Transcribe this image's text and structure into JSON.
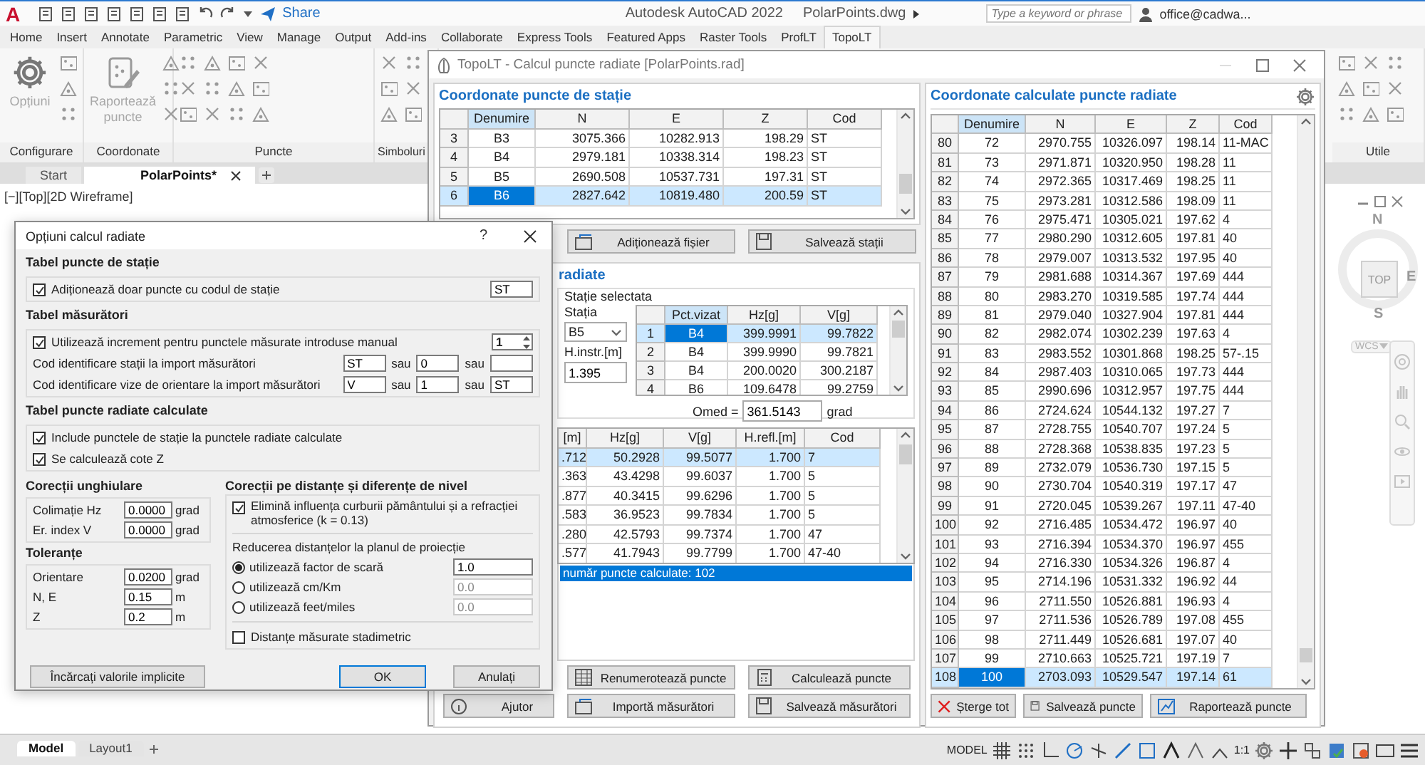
{
  "app": {
    "logo": "A",
    "share": "Share",
    "title": "Autodesk AutoCAD 2022",
    "file": "PolarPoints.dwg",
    "search_placeholder": "Type a keyword or phrase",
    "user": "office@cadwa..."
  },
  "ribbon_tabs": [
    {
      "label": "Home",
      "selected": false
    },
    {
      "label": "Insert",
      "selected": false
    },
    {
      "label": "Annotate",
      "selected": false
    },
    {
      "label": "Parametric",
      "selected": false
    },
    {
      "label": "View",
      "selected": false
    },
    {
      "label": "Manage",
      "selected": false
    },
    {
      "label": "Output",
      "selected": false
    },
    {
      "label": "Add-ins",
      "selected": false
    },
    {
      "label": "Collaborate",
      "selected": false
    },
    {
      "label": "Express Tools",
      "selected": false
    },
    {
      "label": "Featured Apps",
      "selected": false
    },
    {
      "label": "Raster Tools",
      "selected": false
    },
    {
      "label": "ProfLT",
      "selected": false
    },
    {
      "label": "TopoLT",
      "selected": true
    }
  ],
  "ribbon_panels": [
    {
      "title": "Configurare",
      "kind": "large",
      "tool": "Opțiuni"
    },
    {
      "title": "Coordonate",
      "kind": "large",
      "tool": "Raportează puncte"
    },
    {
      "title": "Puncte",
      "kind": "small"
    },
    {
      "title": "Simboluri",
      "kind": "small"
    },
    {
      "title": "Utile",
      "kind": "small"
    }
  ],
  "doc_tabs": [
    {
      "label": "Start",
      "selected": false
    },
    {
      "label": "PolarPoints*",
      "selected": true
    }
  ],
  "viewport_label": "[−][Top][2D Wireframe]",
  "viewcube": {
    "north": "N",
    "face": "TOP",
    "east": "E",
    "south": "S",
    "ucs": "WCS"
  },
  "layout_tabs": [
    {
      "label": "Model",
      "selected": true
    },
    {
      "label": "Layout1",
      "selected": false
    }
  ],
  "status_bar": {
    "space": "MODEL",
    "scale": "1:1"
  },
  "topolt": {
    "title": "TopoLT - Calcul puncte radiate [PolarPoints.rad]",
    "stations": {
      "title": "Coordonate puncte de stație",
      "columns": [
        {
          "label": "Denumire",
          "selected": true
        },
        {
          "label": "N",
          "selected": false
        },
        {
          "label": "E",
          "selected": false
        },
        {
          "label": "Z",
          "selected": false
        },
        {
          "label": "Cod",
          "selected": false
        }
      ],
      "rows": [
        {
          "index": "3",
          "cells": [
            "B3",
            "3075.366",
            "10282.913",
            "198.29",
            "ST"
          ],
          "selected": false
        },
        {
          "index": "4",
          "cells": [
            "B4",
            "2979.181",
            "10338.314",
            "198.23",
            "ST"
          ],
          "selected": false
        },
        {
          "index": "5",
          "cells": [
            "B5",
            "2690.508",
            "10537.731",
            "197.31",
            "ST"
          ],
          "selected": false
        },
        {
          "index": "6",
          "cells": [
            "B6",
            "2827.642",
            "10819.480",
            "200.59",
            "ST"
          ],
          "selected": true
        }
      ]
    },
    "station_buttons": [
      "Adiționează fișier",
      "Salvează stații"
    ],
    "measurements": {
      "title": "radiate",
      "group": "Stație selectata",
      "station_label": "Stația",
      "station_value": "B5",
      "height_label": "H.instr.[m]",
      "height_value": "1.395",
      "sights": {
        "columns": [
          {
            "label": "Pct.vizat",
            "selected": true
          },
          {
            "label": "Hz[g]",
            "selected": false
          },
          {
            "label": "V[g]",
            "selected": false
          }
        ],
        "rows": [
          {
            "index": "1",
            "cells": [
              "B4",
              "399.9991",
              "99.7822"
            ],
            "selected": true
          },
          {
            "index": "2",
            "cells": [
              "B4",
              "399.9990",
              "99.7821"
            ],
            "selected": false
          },
          {
            "index": "3",
            "cells": [
              "B4",
              "200.0020",
              "300.2187"
            ],
            "selected": false
          },
          {
            "index": "4",
            "cells": [
              "B6",
              "109.6478",
              "99.2759"
            ],
            "selected": false
          }
        ]
      },
      "omed_label": "Omed =",
      "omed_value": "361.5143",
      "omed_unit": "grad"
    },
    "observations": {
      "columns": [
        {
          "label": "[m]",
          "selected": false
        },
        {
          "label": "Hz[g]",
          "selected": false
        },
        {
          "label": "V[g]",
          "selected": false
        },
        {
          "label": "H.refl.[m]",
          "selected": false
        },
        {
          "label": "Cod",
          "selected": false
        }
      ],
      "rows": [
        {
          "cells": [
            ".712",
            "50.2928",
            "99.5077",
            "1.700",
            "7"
          ],
          "selected": true
        },
        {
          "cells": [
            ".363",
            "43.4298",
            "99.6037",
            "1.700",
            "5"
          ],
          "selected": false
        },
        {
          "cells": [
            ".877",
            "40.3415",
            "99.6296",
            "1.700",
            "5"
          ],
          "selected": false
        },
        {
          "cells": [
            ".583",
            "36.9523",
            "99.7834",
            "1.700",
            "5"
          ],
          "selected": false
        },
        {
          "cells": [
            ".280",
            "42.5793",
            "99.7374",
            "1.700",
            "47"
          ],
          "selected": false
        },
        {
          "cells": [
            ".577",
            "41.7943",
            "99.7799",
            "1.700",
            "47-40"
          ],
          "selected": false
        }
      ]
    },
    "log": [
      {
        "text": "număr puncte calculate: 102",
        "selected": true
      }
    ],
    "buttons": [
      "Renumerotează puncte",
      "Calculează puncte",
      "Importă măsurători",
      "Salvează măsurători"
    ],
    "help_button": "Ajutor",
    "results": {
      "title": "Coordonate calculate puncte radiate",
      "columns": [
        {
          "label": "Denumire",
          "selected": true
        },
        {
          "label": "N",
          "selected": false
        },
        {
          "label": "E",
          "selected": false
        },
        {
          "label": "Z",
          "selected": false
        },
        {
          "label": "Cod",
          "selected": false
        }
      ],
      "rows": [
        {
          "index": "80",
          "cells": [
            "72",
            "2970.755",
            "10326.097",
            "198.14",
            "11-MAC"
          ],
          "selected": false
        },
        {
          "index": "81",
          "cells": [
            "73",
            "2971.871",
            "10320.950",
            "198.28",
            "11"
          ],
          "selected": false
        },
        {
          "index": "82",
          "cells": [
            "74",
            "2972.365",
            "10317.469",
            "198.25",
            "11"
          ],
          "selected": false
        },
        {
          "index": "83",
          "cells": [
            "75",
            "2973.281",
            "10312.586",
            "198.09",
            "11"
          ],
          "selected": false
        },
        {
          "index": "84",
          "cells": [
            "76",
            "2975.471",
            "10305.021",
            "197.62",
            "4"
          ],
          "selected": false
        },
        {
          "index": "85",
          "cells": [
            "77",
            "2980.290",
            "10312.605",
            "197.81",
            "40"
          ],
          "selected": false
        },
        {
          "index": "86",
          "cells": [
            "78",
            "2979.007",
            "10313.532",
            "197.95",
            "40"
          ],
          "selected": false
        },
        {
          "index": "87",
          "cells": [
            "79",
            "2981.688",
            "10314.367",
            "197.69",
            "444"
          ],
          "selected": false
        },
        {
          "index": "88",
          "cells": [
            "80",
            "2983.270",
            "10319.585",
            "197.74",
            "444"
          ],
          "selected": false
        },
        {
          "index": "89",
          "cells": [
            "81",
            "2979.040",
            "10327.904",
            "197.81",
            "444"
          ],
          "selected": false
        },
        {
          "index": "90",
          "cells": [
            "82",
            "2982.074",
            "10302.239",
            "197.63",
            "4"
          ],
          "selected": false
        },
        {
          "index": "91",
          "cells": [
            "83",
            "2983.552",
            "10301.868",
            "198.25",
            "57-.15"
          ],
          "selected": false
        },
        {
          "index": "92",
          "cells": [
            "84",
            "2987.403",
            "10310.065",
            "197.73",
            "444"
          ],
          "selected": false
        },
        {
          "index": "93",
          "cells": [
            "85",
            "2990.696",
            "10312.957",
            "197.75",
            "444"
          ],
          "selected": false
        },
        {
          "index": "94",
          "cells": [
            "86",
            "2724.624",
            "10544.132",
            "197.27",
            "7"
          ],
          "selected": false
        },
        {
          "index": "95",
          "cells": [
            "87",
            "2728.755",
            "10540.707",
            "197.24",
            "5"
          ],
          "selected": false
        },
        {
          "index": "96",
          "cells": [
            "88",
            "2728.368",
            "10538.835",
            "197.23",
            "5"
          ],
          "selected": false
        },
        {
          "index": "97",
          "cells": [
            "89",
            "2732.079",
            "10536.730",
            "197.15",
            "5"
          ],
          "selected": false
        },
        {
          "index": "98",
          "cells": [
            "90",
            "2730.704",
            "10540.319",
            "197.17",
            "47"
          ],
          "selected": false
        },
        {
          "index": "99",
          "cells": [
            "91",
            "2720.045",
            "10539.267",
            "197.11",
            "47-40"
          ],
          "selected": false
        },
        {
          "index": "100",
          "cells": [
            "92",
            "2716.485",
            "10534.472",
            "196.97",
            "40"
          ],
          "selected": false
        },
        {
          "index": "101",
          "cells": [
            "93",
            "2716.394",
            "10534.370",
            "196.97",
            "455"
          ],
          "selected": false
        },
        {
          "index": "102",
          "cells": [
            "94",
            "2716.330",
            "10534.326",
            "196.87",
            "4"
          ],
          "selected": false
        },
        {
          "index": "103",
          "cells": [
            "95",
            "2714.196",
            "10531.332",
            "196.92",
            "44"
          ],
          "selected": false
        },
        {
          "index": "104",
          "cells": [
            "96",
            "2711.550",
            "10526.881",
            "196.93",
            "4"
          ],
          "selected": false
        },
        {
          "index": "105",
          "cells": [
            "97",
            "2711.536",
            "10526.789",
            "197.08",
            "455"
          ],
          "selected": false
        },
        {
          "index": "106",
          "cells": [
            "98",
            "2711.449",
            "10526.681",
            "197.07",
            "40"
          ],
          "selected": false
        },
        {
          "index": "107",
          "cells": [
            "99",
            "2710.663",
            "10525.721",
            "197.19",
            "7"
          ],
          "selected": false
        },
        {
          "index": "108",
          "cells": [
            "100",
            "2703.093",
            "10529.547",
            "197.14",
            "61"
          ],
          "selected": true
        }
      ]
    },
    "result_buttons": [
      "Șterge tot",
      "Salvează puncte",
      "Raportează puncte"
    ]
  },
  "dialog": {
    "title": "Opțiuni calcul radiate",
    "help": "?",
    "stations": {
      "heading": "Tabel puncte de stație",
      "option": {
        "label": "Adiționează doar puncte cu codul de stație",
        "checked": true
      },
      "code": "ST"
    },
    "measurements": {
      "heading": "Tabel măsurători",
      "option": {
        "label": "Utilizează increment pentru punctele măsurate introduse manual",
        "checked": true
      },
      "increment": "1",
      "code_rows": [
        {
          "label": "Cod identificare stații la import măsurători",
          "fields": [
            {
              "value": "ST"
            },
            {
              "prefix": "sau",
              "value": "0"
            },
            {
              "prefix": "sau"
            }
          ]
        },
        {
          "label": "Cod identificare vize de orientare la import măsurători",
          "fields": [
            {
              "value": "V"
            },
            {
              "prefix": "sau",
              "value": "1"
            },
            {
              "prefix": "sau",
              "value": "ST"
            }
          ]
        }
      ]
    },
    "computed": {
      "heading": "Tabel puncte radiate calculate",
      "options": [
        {
          "label": "Include punctele de stație la punctele radiate calculate",
          "checked": true
        },
        {
          "label": "Se calculează cote Z",
          "checked": true
        }
      ]
    },
    "angular": {
      "heading": "Corecții unghiulare",
      "fields": [
        {
          "label": "Colimație Hz",
          "value": "0.0000",
          "unit": "grad"
        },
        {
          "label": "Er. index V",
          "value": "0.0000",
          "unit": "grad"
        }
      ]
    },
    "tolerances": {
      "heading": "Toleranțe",
      "fields": [
        {
          "label": "Orientare",
          "value": "0.0200",
          "unit": "grad"
        },
        {
          "label": "N, E",
          "value": "0.15",
          "unit": "m"
        },
        {
          "label": "Z",
          "value": "0.2",
          "unit": "m"
        }
      ]
    },
    "distances": {
      "heading": "Corecții pe distanțe și diferențe de nivel",
      "curvature": {
        "label": "Elimină influența curburii pământului și a refracției atmosferice (k = 0.13)",
        "checked": true
      },
      "reduction_label": "Reducerea distanțelor la planul de proiecție",
      "methods": [
        {
          "label": "utilizează factor de scară",
          "value": "1.0",
          "selected": true
        },
        {
          "label": "utilizează cm/Km",
          "value": "0.0",
          "selected": false
        },
        {
          "label": "utilizează feet/miles",
          "value": "0.0",
          "selected": false
        }
      ],
      "stadia": {
        "label": "Distanțe măsurate stadimetric",
        "checked": false
      }
    },
    "buttons": [
      {
        "label": "Încărcați valorile implicite",
        "kind": "reset"
      },
      {
        "label": "OK",
        "kind": "default"
      },
      {
        "label": "Anulați",
        "kind": "cancel"
      }
    ]
  }
}
